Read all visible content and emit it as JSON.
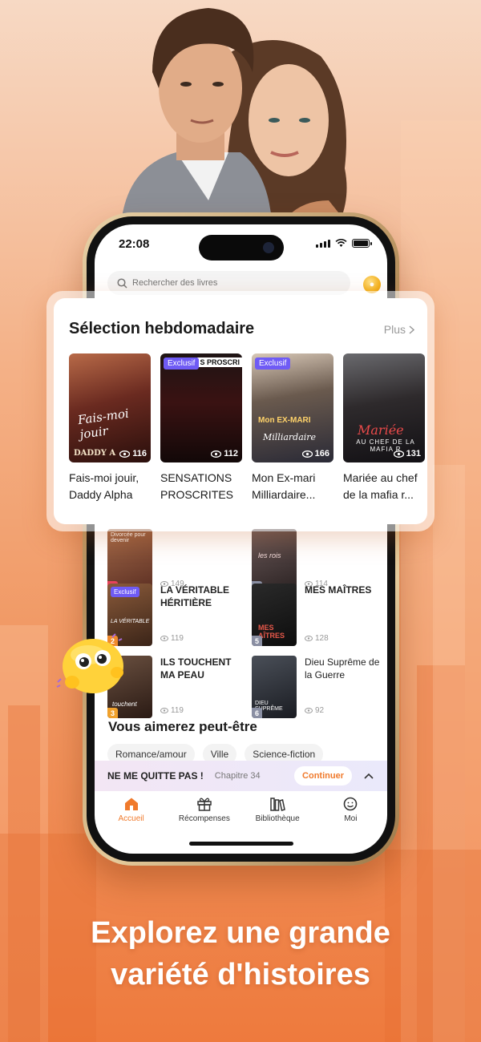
{
  "colors": {
    "accent": "#f07a2c",
    "badge": "#6f5bf5",
    "rank_1": "#e8425a",
    "rank_2": "#f08a2c",
    "rank_3": "#f0a12c",
    "rank_other": "#8a8fa3"
  },
  "status_bar": {
    "time": "22:08",
    "icons": [
      "signal-icon",
      "wifi-icon",
      "battery-icon"
    ]
  },
  "search": {
    "placeholder": "Rechercher des livres",
    "icon": "search-icon"
  },
  "weekly": {
    "title": "Sélection hebdomadaire",
    "more_label": "Plus",
    "books": [
      {
        "title": "Fais-moi jouir, Daddy Alpha",
        "views": "116",
        "exclusive": false,
        "cover_text": "Fais-moi jouir",
        "cover_sub": "DADDY A"
      },
      {
        "title": "SENSATIONS PROSCRITES",
        "views": "112",
        "exclusive": true,
        "badge": "Exclusif",
        "cover_text": "S PROSCRI",
        "cover_sub": ""
      },
      {
        "title": "Mon Ex-mari Milliardaire...",
        "views": "166",
        "exclusive": true,
        "badge": "Exclusif",
        "cover_text": "Mon EX-MARI",
        "cover_sub": "Milliardaire"
      },
      {
        "title": "Mariée au chef de la mafia r...",
        "views": "131",
        "exclusive": false,
        "cover_text": "Mariée",
        "cover_sub": "AU CHEF DE LA MAFIA R"
      }
    ]
  },
  "ranking": {
    "items": [
      {
        "rank": "1",
        "title": "",
        "views": "149",
        "cover_text": "Divorcée pour devenir"
      },
      {
        "rank": "4",
        "title": "",
        "views": "114",
        "cover_text": "les rois"
      },
      {
        "rank": "2",
        "title": "LA VÉRITABLE HÉRITIÈRE",
        "views": "119",
        "badge": "Exclusif",
        "cover_text": "LA VÉRITABLE"
      },
      {
        "rank": "5",
        "title": "MES MAÎTRES",
        "views": "128",
        "cover_text": "MES AÎTRES"
      },
      {
        "rank": "3",
        "title": "ILS TOUCHENT MA PEAU",
        "views": "119",
        "cover_text": "touchent"
      },
      {
        "rank": "6",
        "title": "Dieu Suprême de la Guerre",
        "views": "92",
        "cover_text": "DIEU SUPRÊME"
      }
    ]
  },
  "recommend": {
    "title": "Vous aimerez peut-être",
    "chips": [
      "Romance/amour",
      "Ville",
      "Science-fiction"
    ]
  },
  "continue_reading": {
    "book": "NE ME QUITTE PAS !",
    "chapter": "Chapitre 34",
    "button": "Continuer"
  },
  "tabs": [
    {
      "label": "Accueil",
      "icon": "home-icon",
      "active": true
    },
    {
      "label": "Récompenses",
      "icon": "gift-icon",
      "active": false
    },
    {
      "label": "Bibliothèque",
      "icon": "library-icon",
      "active": false
    },
    {
      "label": "Moi",
      "icon": "profile-icon",
      "active": false
    }
  ],
  "tagline": {
    "line1": "Explorez une grande",
    "line2": "variété d'histoires"
  }
}
